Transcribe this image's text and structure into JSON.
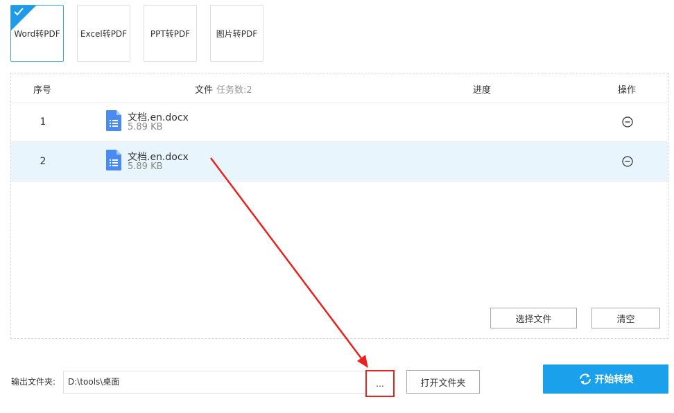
{
  "modes": [
    {
      "label": "Word转PDF",
      "active": true
    },
    {
      "label": "Excel转PDF",
      "active": false
    },
    {
      "label": "PPT转PDF",
      "active": false
    },
    {
      "label": "图片转PDF",
      "active": false
    }
  ],
  "table": {
    "headers": {
      "index": "序号",
      "file": "文件",
      "task_count": "任务数:2",
      "progress": "进度",
      "action": "操作"
    },
    "rows": [
      {
        "index": "1",
        "name": "文档.en.docx",
        "size": "5.89 KB",
        "selected": false
      },
      {
        "index": "2",
        "name": "文档.en.docx",
        "size": "5.89 KB",
        "selected": true
      }
    ]
  },
  "buttons": {
    "select_files": "选择文件",
    "clear": "清空",
    "browse": "...",
    "open_folder": "打开文件夹",
    "start": "开始转换"
  },
  "output": {
    "label": "输出文件夹:",
    "path": "D:\\tools\\桌面"
  },
  "colors": {
    "accent": "#1ba1ec",
    "selected_row": "#e9f5fc",
    "annotation": "#e8231f",
    "file_icon": "#4a8af4"
  },
  "icons": {
    "file": "document-icon",
    "remove": "minus-circle-icon",
    "start": "refresh-icon",
    "active_mode": "check-icon"
  }
}
